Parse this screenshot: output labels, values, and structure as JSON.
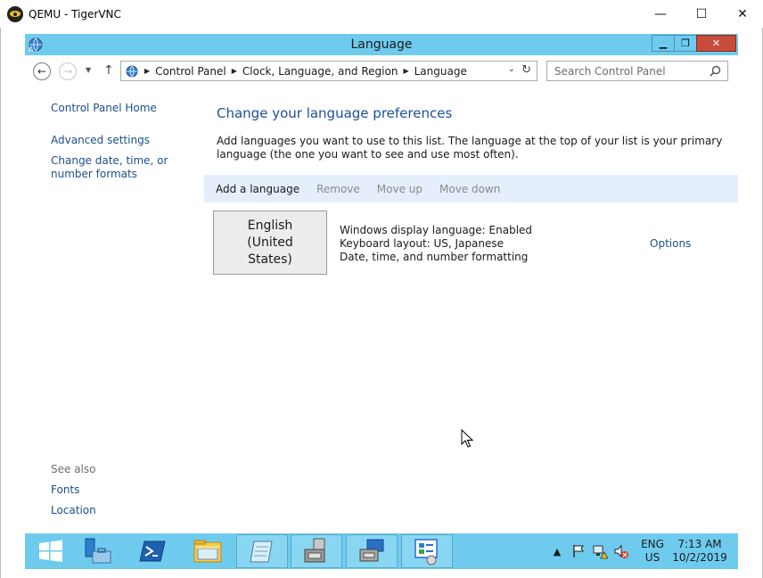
{
  "vnc": {
    "title": "QEMU - TigerVNC",
    "minimize": "—",
    "maximize": "☐",
    "close": "✕"
  },
  "window": {
    "title": "Language",
    "min_glyph": "▁",
    "max_glyph": "❐",
    "close_glyph": "✕"
  },
  "address": {
    "breadcrumbs": [
      "Control Panel",
      "Clock, Language, and Region",
      "Language"
    ],
    "search_placeholder": "Search Control Panel"
  },
  "left_nav": {
    "home": "Control Panel Home",
    "advanced": "Advanced settings",
    "change_date": "Change date, time, or number formats",
    "see_also": "See also",
    "fonts": "Fonts",
    "location": "Location"
  },
  "main": {
    "heading": "Change your language preferences",
    "description": "Add languages you want to use to this list. The language at the top of your list is your primary language (the one you want to see and use most often).",
    "toolbar": {
      "add": "Add a language",
      "remove": "Remove",
      "move_up": "Move up",
      "move_down": "Move down"
    },
    "language": {
      "name": "English (United States)",
      "display": "Windows display language: Enabled",
      "keyboard": "Keyboard layout: US, Japanese",
      "formatting": "Date, time, and number formatting",
      "options": "Options"
    }
  },
  "taskbar": {
    "lang_top": "ENG",
    "lang_bottom": "US",
    "time": "7:13 AM",
    "date": "10/2/2019"
  },
  "colors": {
    "titlebar": "#6ecbee",
    "link": "#1c4f8c",
    "heading": "#1e4f9b",
    "toolbar_bg": "#e5effb",
    "close_btn": "#c84c3c"
  }
}
